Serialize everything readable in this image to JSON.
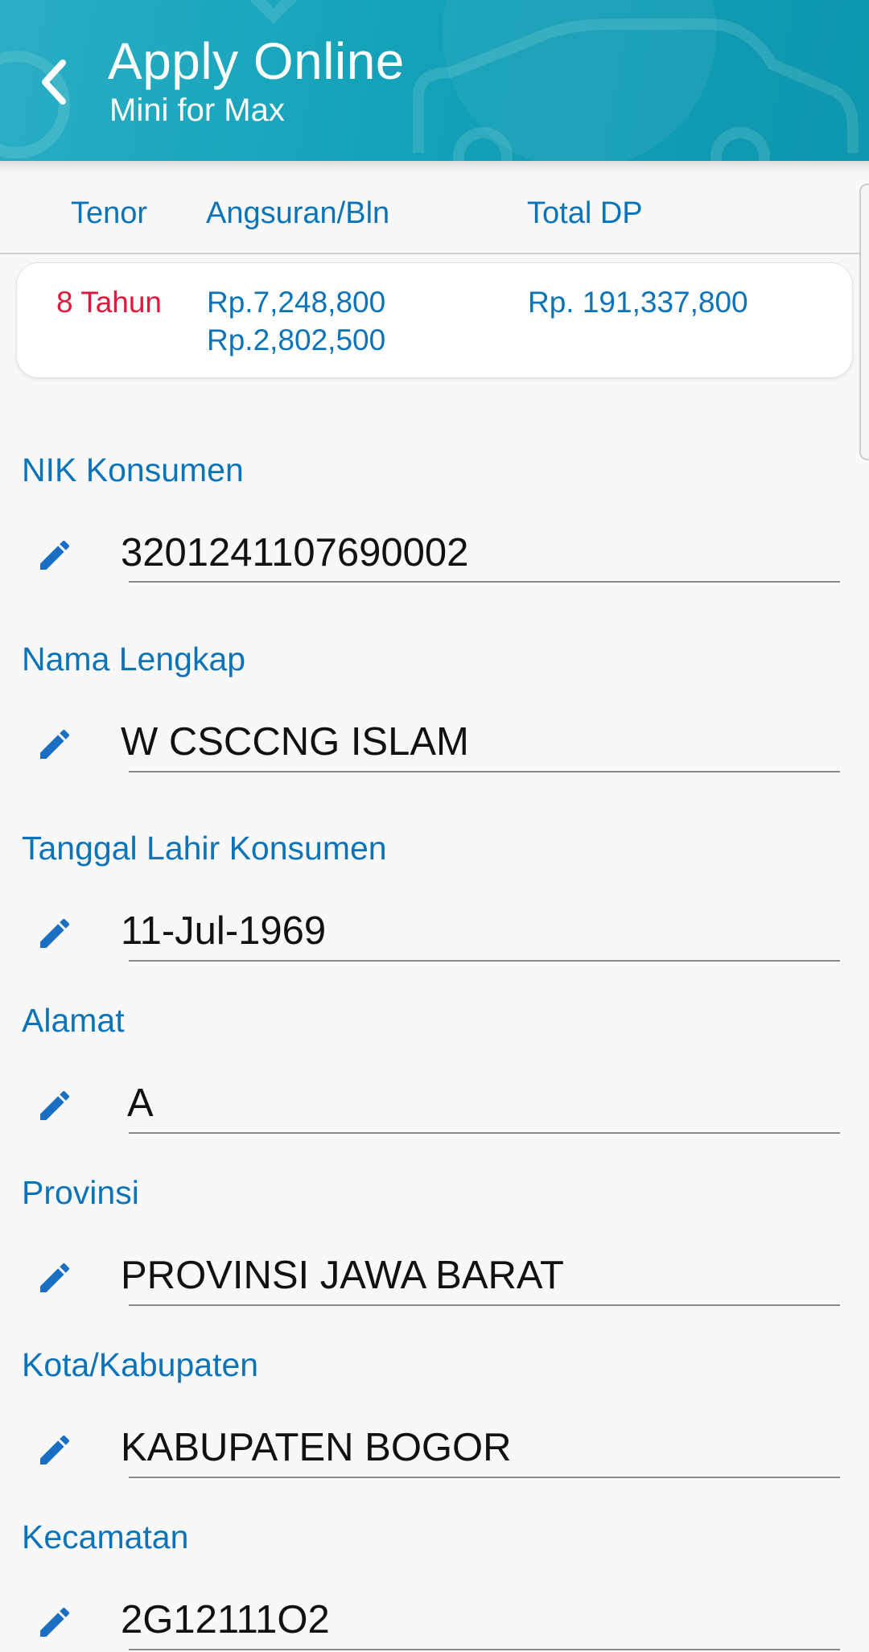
{
  "header": {
    "title": "Apply Online",
    "subtitle": "Mini for Max",
    "back_icon": "chevron-left-icon",
    "colors": {
      "background": "#13a2b9",
      "text": "#ffffff"
    }
  },
  "summary": {
    "columns": [
      "Tenor",
      "Angsuran/Bln",
      "Total DP"
    ],
    "row": {
      "tenor": "8 Tahun",
      "angsuran": [
        "Rp.7,248,800",
        "Rp.2,802,500"
      ],
      "total_dp": "Rp. 191,337,800"
    },
    "colors": {
      "label": "#0b73b8",
      "tenor": "#e3173b"
    }
  },
  "form": {
    "edit_icon": "pencil-icon",
    "fields": [
      {
        "label": "NIK Konsumen",
        "value": "3201241107690002"
      },
      {
        "label": "Nama Lengkap",
        "value": "W CSCCNG ISLAM"
      },
      {
        "label": "Tanggal Lahir Konsumen",
        "value": "11-Jul-1969"
      },
      {
        "label": "Alamat",
        "value": "A"
      },
      {
        "label": "Provinsi",
        "value": "PROVINSI JAWA BARAT"
      },
      {
        "label": "Kota/Kabupaten",
        "value": "KABUPATEN BOGOR"
      },
      {
        "label": "Kecamatan",
        "value": "2G12111O2"
      }
    ]
  }
}
